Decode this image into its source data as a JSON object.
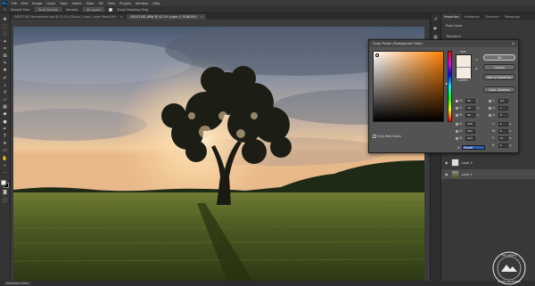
{
  "menubar": {
    "app_icon": "Ps",
    "items": [
      "File",
      "Edit",
      "Image",
      "Layer",
      "Type",
      "Select",
      "Filter",
      "3D",
      "View",
      "Plugins",
      "Window",
      "Help"
    ]
  },
  "options_bar": {
    "tool": "Sample Size:",
    "sample_size": "Point Sample",
    "sample_label": "Sample:",
    "sample_value": "All Layers",
    "show_ring_label": "Show Sampling Ring"
  },
  "doc_tabs": [
    {
      "label": "DSC07181 Remastered.psd @ 12.5% (Group 1 copy, Layer Mask/16*)",
      "active": false
    },
    {
      "label": "DSC07181.ARW @ 42.2% (Layer 2, RGB/16*)",
      "active": true
    }
  ],
  "panel": {
    "tabs": [
      "Properties",
      "Histogram",
      "Character",
      "Paragraph"
    ],
    "props": [
      "Pixel Layer",
      "Transform"
    ],
    "layers": [
      "Layer 2",
      "Layer 1"
    ]
  },
  "color_picker": {
    "title": "Color Picker (Foreground Color)",
    "new_label": "new",
    "current_label": "current",
    "buttons": [
      "OK",
      "Cancel",
      "Add to Swatches",
      "Color Libraries"
    ],
    "hsb": [
      {
        "label": "H:",
        "value": "35",
        "unit": "°",
        "selected": true
      },
      {
        "label": "S:",
        "value": "10",
        "unit": "%",
        "selected": false
      },
      {
        "label": "B:",
        "value": "96",
        "unit": "%",
        "selected": false
      },
      {
        "label": "R:",
        "value": "245",
        "unit": "",
        "selected": false
      },
      {
        "label": "G:",
        "value": "237",
        "unit": "",
        "selected": false
      },
      {
        "label": "B:",
        "value": "223",
        "unit": "",
        "selected": false
      }
    ],
    "lab": [
      {
        "label": "L:",
        "value": "94",
        "unit": ""
      },
      {
        "label": "a:",
        "value": "1",
        "unit": ""
      },
      {
        "label": "b:",
        "value": "8",
        "unit": ""
      },
      {
        "label": "C:",
        "value": "3",
        "unit": "%"
      },
      {
        "label": "M:",
        "value": "6",
        "unit": "%"
      },
      {
        "label": "Y:",
        "value": "12",
        "unit": "%"
      },
      {
        "label": "K:",
        "value": "0",
        "unit": "%"
      }
    ],
    "hex_label": "#",
    "hex_value": "f5eddf",
    "only_web_label": "Only Web Colors",
    "colors": {
      "selected": "#f3ebdf",
      "hue": "#ff8000"
    }
  },
  "status": {
    "label": "Selection Exist."
  },
  "watermark": {
    "top": "THE AERIAL",
    "bottom": "PHOTOGRAPHER"
  }
}
